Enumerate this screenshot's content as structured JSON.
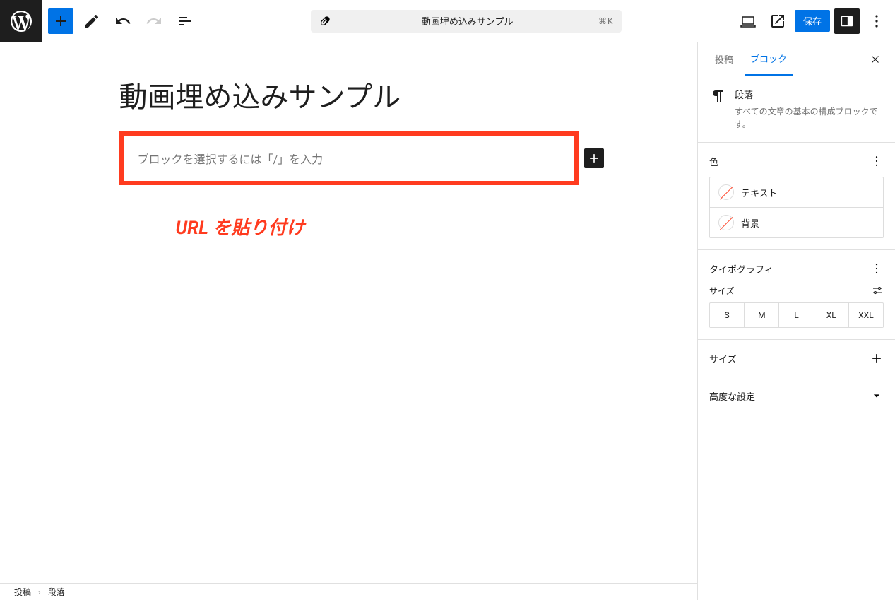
{
  "header": {
    "document_title": "動画埋め込みサンプル",
    "shortcut": "⌘K",
    "save_label": "保存"
  },
  "editor": {
    "post_title": "動画埋め込みサンプル",
    "block_placeholder": "ブロックを選択するには「/」を入力",
    "annotation": "URL を貼り付け"
  },
  "breadcrumb": {
    "root": "投稿",
    "sep": "›",
    "current": "段落"
  },
  "sidebar": {
    "tabs": {
      "post": "投稿",
      "block": "ブロック"
    },
    "block_info": {
      "name": "段落",
      "description": "すべての文章の基本の構成ブロックです。"
    },
    "color": {
      "title": "色",
      "text": "テキスト",
      "background": "背景"
    },
    "typography": {
      "title": "タイポグラフィ",
      "size_label": "サイズ",
      "sizes": [
        "S",
        "M",
        "L",
        "XL",
        "XXL"
      ]
    },
    "size_section": "サイズ",
    "advanced": "高度な設定"
  }
}
